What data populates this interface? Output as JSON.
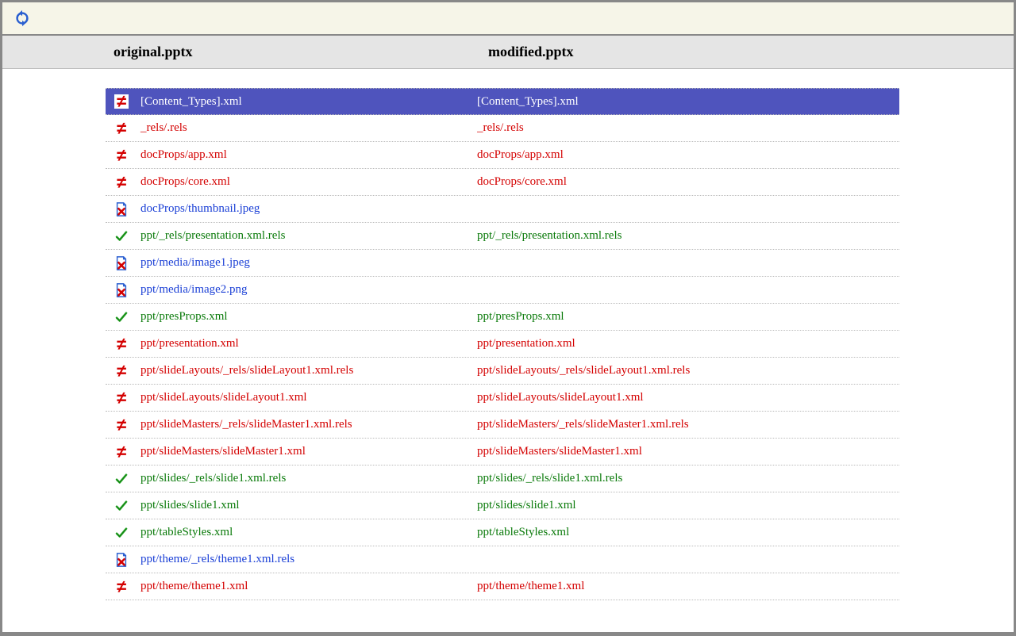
{
  "header": {
    "left_label": "original.pptx",
    "right_label": "modified.pptx"
  },
  "rows": [
    {
      "state": "diff",
      "selected": true,
      "left": "[Content_Types].xml",
      "right": "[Content_Types].xml"
    },
    {
      "state": "diff",
      "selected": false,
      "left": "_rels/.rels",
      "right": "_rels/.rels"
    },
    {
      "state": "diff",
      "selected": false,
      "left": "docProps/app.xml",
      "right": "docProps/app.xml"
    },
    {
      "state": "diff",
      "selected": false,
      "left": "docProps/core.xml",
      "right": "docProps/core.xml"
    },
    {
      "state": "del",
      "selected": false,
      "left": "docProps/thumbnail.jpeg",
      "right": ""
    },
    {
      "state": "same",
      "selected": false,
      "left": "ppt/_rels/presentation.xml.rels",
      "right": "ppt/_rels/presentation.xml.rels"
    },
    {
      "state": "del",
      "selected": false,
      "left": "ppt/media/image1.jpeg",
      "right": ""
    },
    {
      "state": "del",
      "selected": false,
      "left": "ppt/media/image2.png",
      "right": ""
    },
    {
      "state": "same",
      "selected": false,
      "left": "ppt/presProps.xml",
      "right": "ppt/presProps.xml"
    },
    {
      "state": "diff",
      "selected": false,
      "left": "ppt/presentation.xml",
      "right": "ppt/presentation.xml"
    },
    {
      "state": "diff",
      "selected": false,
      "left": "ppt/slideLayouts/_rels/slideLayout1.xml.rels",
      "right": "ppt/slideLayouts/_rels/slideLayout1.xml.rels"
    },
    {
      "state": "diff",
      "selected": false,
      "left": "ppt/slideLayouts/slideLayout1.xml",
      "right": "ppt/slideLayouts/slideLayout1.xml"
    },
    {
      "state": "diff",
      "selected": false,
      "left": "ppt/slideMasters/_rels/slideMaster1.xml.rels",
      "right": "ppt/slideMasters/_rels/slideMaster1.xml.rels"
    },
    {
      "state": "diff",
      "selected": false,
      "left": "ppt/slideMasters/slideMaster1.xml",
      "right": "ppt/slideMasters/slideMaster1.xml"
    },
    {
      "state": "same",
      "selected": false,
      "left": "ppt/slides/_rels/slide1.xml.rels",
      "right": "ppt/slides/_rels/slide1.xml.rels"
    },
    {
      "state": "same",
      "selected": false,
      "left": "ppt/slides/slide1.xml",
      "right": "ppt/slides/slide1.xml"
    },
    {
      "state": "same",
      "selected": false,
      "left": "ppt/tableStyles.xml",
      "right": "ppt/tableStyles.xml"
    },
    {
      "state": "del",
      "selected": false,
      "left": "ppt/theme/_rels/theme1.xml.rels",
      "right": ""
    },
    {
      "state": "diff",
      "selected": false,
      "left": "ppt/theme/theme1.xml",
      "right": "ppt/theme/theme1.xml"
    }
  ]
}
